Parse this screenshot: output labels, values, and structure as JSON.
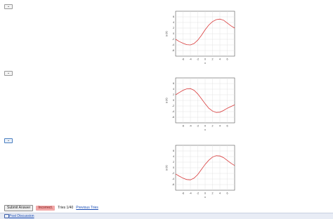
{
  "questions": [
    {
      "select_value": "",
      "plot": {
        "ylabel": "y (x)",
        "xlabel": "x"
      }
    },
    {
      "select_value": "",
      "plot": {
        "ylabel": "y (x)",
        "xlabel": "x"
      }
    },
    {
      "select_value": "",
      "plot": {
        "ylabel": "y (x)",
        "xlabel": "x"
      }
    }
  ],
  "chart_data": [
    {
      "type": "line",
      "xlabel": "x",
      "ylabel": "y (x)",
      "xlim": [
        -8,
        8
      ],
      "ylim": [
        -8,
        8
      ],
      "xticks": [
        "-6",
        "-4",
        "-2",
        "0",
        "2",
        "4",
        "6"
      ],
      "yticks": [
        "6",
        "4",
        "2",
        "0",
        "-2",
        "-4",
        "-6"
      ],
      "series": [
        {
          "x": [
            -8,
            -7,
            -6,
            -5,
            -4,
            -3,
            -2,
            -1,
            0,
            1,
            2,
            3,
            4,
            5,
            6,
            7,
            8
          ],
          "y": [
            -2,
            -2.8,
            -3.4,
            -3.9,
            -4,
            -3.5,
            -2.3,
            -0.6,
            1.4,
            3.1,
            4.3,
            5,
            5.2,
            4.8,
            3.8,
            2.8,
            2
          ]
        }
      ],
      "color": "#d93a3a",
      "grid": true
    },
    {
      "type": "line",
      "xlabel": "x",
      "ylabel": "y (x)",
      "xlim": [
        -8,
        8
      ],
      "ylim": [
        -8,
        8
      ],
      "xticks": [
        "-6",
        "-4",
        "-2",
        "0",
        "2",
        "4",
        "6"
      ],
      "yticks": [
        "6",
        "4",
        "2",
        "0",
        "-2",
        "-4",
        "-6"
      ],
      "series": [
        {
          "x": [
            -8,
            -7,
            -6,
            -5,
            -4,
            -3,
            -2,
            -1,
            0,
            1,
            2,
            3,
            4,
            5,
            6,
            7,
            8
          ],
          "y": [
            2,
            2.8,
            3.6,
            4.1,
            4.2,
            3.6,
            2.3,
            0.6,
            -1.2,
            -2.8,
            -3.8,
            -4.3,
            -4.2,
            -3.6,
            -2.8,
            -2.2,
            -1.6
          ]
        }
      ],
      "color": "#d93a3a",
      "grid": true
    },
    {
      "type": "line",
      "xlabel": "x",
      "ylabel": "y (x)",
      "xlim": [
        -8,
        8
      ],
      "ylim": [
        -8,
        8
      ],
      "xticks": [
        "-6",
        "-4",
        "-2",
        "0",
        "2",
        "4",
        "6"
      ],
      "yticks": [
        "6",
        "4",
        "2",
        "0",
        "-2",
        "-4",
        "-6"
      ],
      "series": [
        {
          "x": [
            -8,
            -7,
            -6,
            -5,
            -4,
            -3,
            -2,
            -1,
            0,
            1,
            2,
            3,
            4,
            5,
            6,
            7,
            8
          ],
          "y": [
            -2.2,
            -3,
            -3.7,
            -4.2,
            -4.3,
            -3.7,
            -2.4,
            -0.6,
            1.2,
            2.7,
            3.8,
            4.3,
            4.2,
            3.6,
            2.6,
            1.6,
            0.8
          ]
        }
      ],
      "color": "#d93a3a",
      "grid": true
    }
  ],
  "controls": {
    "submit_label": "Submit Answer",
    "status_label": "Incorrect.",
    "tries_text": "Tries 1/40",
    "previous_tries_label": "Previous Tries"
  },
  "footer": {
    "post_discussion_label": "Post Discussion",
    "icon": "discussion-icon"
  }
}
